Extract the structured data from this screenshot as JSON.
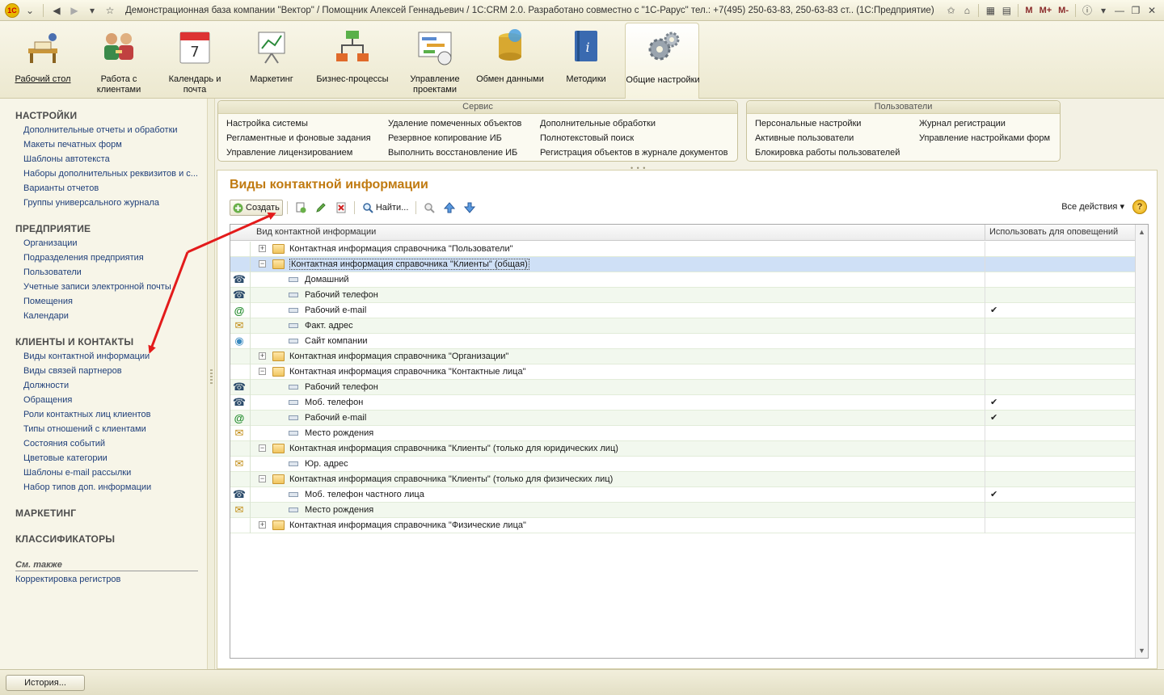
{
  "window": {
    "title": "Демонстрационная база компании \"Вектор\" / Помощник Алексей Геннадьевич / 1С:CRM 2.0. Разработано совместно с \"1С-Рарус\" тел.: +7(495) 250-63-83, 250-63-83 ст.. (1С:Предприятие)",
    "right_labels": [
      "M",
      "M+",
      "M-"
    ]
  },
  "sections": [
    {
      "label": "Рабочий стол",
      "icon": "desk-icon"
    },
    {
      "label": "Работа с клиентами",
      "icon": "clients-icon"
    },
    {
      "label": "Календарь и почта",
      "icon": "calendar-icon"
    },
    {
      "label": "Маркетинг",
      "icon": "marketing-icon"
    },
    {
      "label": "Бизнес-процессы",
      "icon": "business-process-icon"
    },
    {
      "label": "Управление проектами",
      "icon": "project-icon"
    },
    {
      "label": "Обмен данными",
      "icon": "data-exchange-icon"
    },
    {
      "label": "Методики",
      "icon": "methods-icon"
    },
    {
      "label": "Общие настройки",
      "icon": "settings-gears-icon"
    }
  ],
  "leftnav": {
    "groups": [
      {
        "title": "НАСТРОЙКИ",
        "items": [
          "Дополнительные отчеты и обработки",
          "Макеты печатных форм",
          "Шаблоны автотекста",
          "Наборы дополнительных реквизитов и с...",
          "Варианты отчетов",
          "Группы универсального журнала"
        ]
      },
      {
        "title": "ПРЕДПРИЯТИЕ",
        "items": [
          "Организации",
          "Подразделения предприятия",
          "Пользователи",
          "Учетные записи электронной почты",
          "Помещения",
          "Календари"
        ]
      },
      {
        "title": "КЛИЕНТЫ И КОНТАКТЫ",
        "items": [
          "Виды контактной информации",
          "Виды связей партнеров",
          "Должности",
          "Обращения",
          "Роли контактных лиц клиентов",
          "Типы отношений с клиентами",
          "Состояния событий",
          "Цветовые категории",
          "Шаблоны e-mail рассылки",
          "Набор типов доп. информации"
        ]
      },
      {
        "title": "МАРКЕТИНГ",
        "items": []
      },
      {
        "title": "КЛАССИФИКАТОРЫ",
        "items": []
      }
    ],
    "see_also": "См. также",
    "see_also_items": [
      "Корректировка регистров"
    ]
  },
  "service_panel": {
    "title": "Сервис",
    "columns": [
      [
        "Настройка системы",
        "Регламентные и фоновые задания",
        "Управление лицензированием"
      ],
      [
        "Удаление помеченных объектов",
        "Резервное копирование ИБ",
        "Выполнить восстановление ИБ"
      ],
      [
        "Дополнительные обработки",
        "Полнотекстовый поиск",
        "Регистрация объектов в журнале документов"
      ]
    ]
  },
  "users_panel": {
    "title": "Пользователи",
    "columns": [
      [
        "Персональные настройки",
        "Активные пользователи",
        "Блокировка работы пользователей"
      ],
      [
        "Журнал регистрации",
        "Управление настройками форм"
      ]
    ]
  },
  "form": {
    "title": "Виды контактной информации",
    "toolbar": {
      "create": "Создать",
      "find": "Найти...",
      "all_actions": "Все действия",
      "help": "?"
    },
    "columns": [
      "Вид контактной информации",
      "Использовать для оповещений"
    ],
    "rows": [
      {
        "type": "group",
        "expand": "+",
        "text": "Контактная информация справочника \"Пользователи\"",
        "check": false
      },
      {
        "type": "group",
        "expand": "−",
        "text": "Контактная информация справочника \"Клиенты\" (общая)",
        "check": false,
        "selected": true
      },
      {
        "type": "item",
        "icon": "phone-icon",
        "text": "Домашний",
        "check": false
      },
      {
        "type": "item",
        "icon": "phone-icon",
        "text": "Рабочий телефон",
        "check": false
      },
      {
        "type": "item",
        "icon": "at-sign-icon",
        "text": "Рабочий e-mail",
        "check": true
      },
      {
        "type": "item",
        "icon": "envelope-icon",
        "text": "Факт. адрес",
        "check": false
      },
      {
        "type": "item",
        "icon": "globe-icon",
        "text": "Сайт компании",
        "check": false
      },
      {
        "type": "group",
        "expand": "+",
        "text": "Контактная информация справочника \"Организации\"",
        "check": false
      },
      {
        "type": "group",
        "expand": "−",
        "text": "Контактная информация справочника \"Контактные лица\"",
        "check": false
      },
      {
        "type": "item",
        "icon": "phone-icon",
        "text": "Рабочий телефон",
        "check": false
      },
      {
        "type": "item",
        "icon": "phone-icon",
        "text": "Моб. телефон",
        "check": true
      },
      {
        "type": "item",
        "icon": "at-sign-icon",
        "text": "Рабочий e-mail",
        "check": true
      },
      {
        "type": "item",
        "icon": "envelope-icon",
        "text": "Место рождения",
        "check": false
      },
      {
        "type": "group",
        "expand": "−",
        "text": "Контактная информация справочника \"Клиенты\" (только для юридических лиц)",
        "check": false
      },
      {
        "type": "item",
        "icon": "envelope-icon",
        "text": "Юр. адрес",
        "check": false
      },
      {
        "type": "group",
        "expand": "−",
        "text": "Контактная информация справочника \"Клиенты\" (только для физических лиц)",
        "check": false
      },
      {
        "type": "item",
        "icon": "phone-icon",
        "text": "Моб. телефон частного лица",
        "check": true
      },
      {
        "type": "item",
        "icon": "envelope-icon",
        "text": "Место рождения",
        "check": false
      },
      {
        "type": "group",
        "expand": "+",
        "text": "Контактная информация справочника \"Физические лица\"",
        "check": false
      }
    ]
  },
  "bottom": {
    "history_button": "История..."
  },
  "colors": {
    "accent_title": "#c07a10",
    "link": "#1f3f7a",
    "selected_row": "#cfe0f6",
    "alt_row": "#f2f8ee",
    "annotation_arrow": "#e31b1b"
  }
}
